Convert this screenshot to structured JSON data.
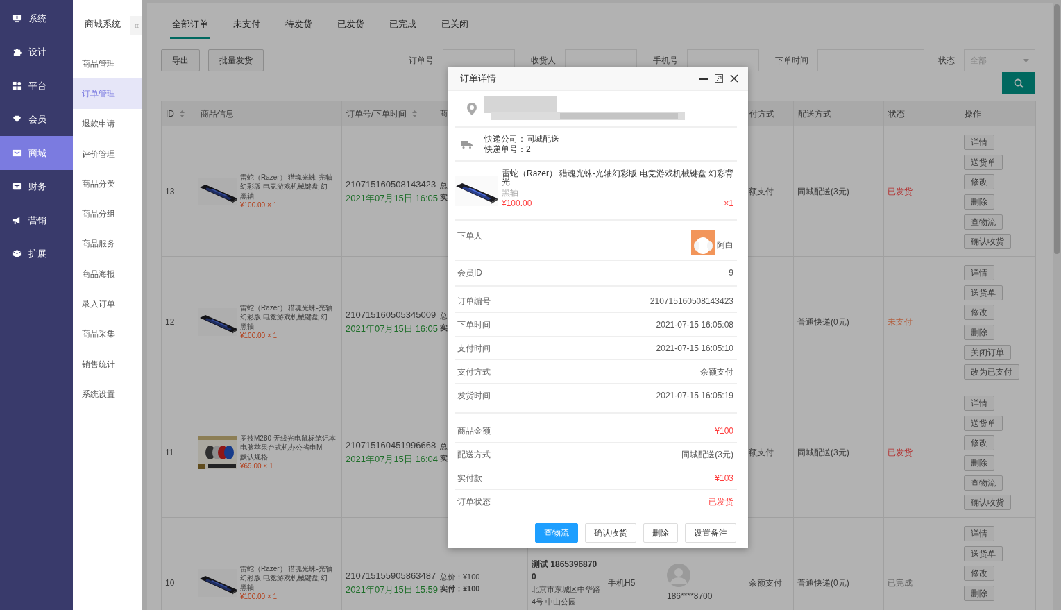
{
  "sidebar": {
    "items": [
      {
        "label": "系统",
        "selected": false
      },
      {
        "label": "设计",
        "selected": false
      },
      {
        "label": "平台",
        "selected": false
      },
      {
        "label": "会员",
        "selected": false
      },
      {
        "label": "商城",
        "selected": true
      },
      {
        "label": "财务",
        "selected": false
      },
      {
        "label": "营销",
        "selected": false
      },
      {
        "label": "扩展",
        "selected": false
      }
    ]
  },
  "subnav": {
    "title": "商城系统",
    "collapse": "«",
    "items": [
      {
        "label": "商品管理",
        "selected": false
      },
      {
        "label": "订单管理",
        "selected": true
      },
      {
        "label": "退款申请",
        "selected": false
      },
      {
        "label": "评价管理",
        "selected": false
      },
      {
        "label": "商品分类",
        "selected": false
      },
      {
        "label": "商品分组",
        "selected": false
      },
      {
        "label": "商品服务",
        "selected": false
      },
      {
        "label": "商品海报",
        "selected": false
      },
      {
        "label": "录入订单",
        "selected": false
      },
      {
        "label": "商品采集",
        "selected": false
      },
      {
        "label": "销售统计",
        "selected": false
      },
      {
        "label": "系统设置",
        "selected": false
      }
    ]
  },
  "tabs": [
    {
      "label": "全部订单",
      "selected": true
    },
    {
      "label": "未支付",
      "selected": false
    },
    {
      "label": "待发货",
      "selected": false
    },
    {
      "label": "已发货",
      "selected": false
    },
    {
      "label": "已完成",
      "selected": false
    },
    {
      "label": "已关闭",
      "selected": false
    }
  ],
  "toolbar": {
    "buttons": [
      "导出",
      "批量发货"
    ],
    "filters": [
      {
        "label": "订单号",
        "kind": "input"
      },
      {
        "label": "收货人",
        "kind": "input"
      },
      {
        "label": "手机号",
        "kind": "input"
      },
      {
        "label": "下单时间",
        "kind": "wide"
      },
      {
        "label": "状态",
        "kind": "select",
        "placeholder": "全部"
      }
    ]
  },
  "table": {
    "columns": [
      {
        "label": "ID",
        "sortable": true
      },
      {
        "label": "商品信息",
        "sortable": false
      },
      {
        "label": "订单号/下单时间",
        "sortable": true
      },
      {
        "label": "商"
      },
      {
        "label": "付方式",
        "sortable": false
      },
      {
        "label": "配送方式",
        "sortable": false
      },
      {
        "label": "状态",
        "sortable": false
      },
      {
        "label": "操作",
        "sortable": false
      }
    ],
    "rows": [
      {
        "id": "13",
        "product": {
          "name": "雷蛇（Razer） 猎魂光蛛-光轴幻彩版 电竞游戏机械键盘 幻",
          "spec": "黑轴",
          "price": "¥100.00 × 1"
        },
        "order": {
          "number": "210715160508143423",
          "time": "2021年07月15日 16:05"
        },
        "amount": {
          "total": "总",
          "paid": "实"
        },
        "pay": "额支付",
        "shipping": "同城配送(3元)",
        "status": {
          "text": "已发货",
          "kind": "shipped"
        },
        "actions": [
          "详情",
          "送货单",
          "修改",
          "删除",
          "查物流",
          "确认收货"
        ]
      },
      {
        "id": "12",
        "product": {
          "name": "雷蛇（Razer） 猎魂光蛛-光轴幻彩版 电竞游戏机械键盘 幻",
          "spec": "黑轴",
          "price": "¥100.00 × 1"
        },
        "order": {
          "number": "210715160505345009",
          "time": "2021年07月15日 16:05"
        },
        "amount": {
          "total": "总",
          "paid": "实"
        },
        "shipping": "普通快递(0元)",
        "status": {
          "text": "未支付",
          "kind": "unpaid"
        },
        "actions": [
          "详情",
          "送货单",
          "修改",
          "删除",
          "关闭订单",
          "改为已支付"
        ]
      },
      {
        "id": "11",
        "product": {
          "name": "罗技M280 无线光电鼠标笔记本电脑苹果台式机办公省电M",
          "spec": "默认规格",
          "price": "¥69.00 × 1"
        },
        "order": {
          "number": "210715160451996668",
          "time": "2021年07月15日 16:04"
        },
        "amount": {
          "total": "总",
          "paid": "实"
        },
        "pay": "额支付",
        "shipping": "同城配送(3元)",
        "status": {
          "text": "已发货",
          "kind": "shipped"
        },
        "actions": [
          "详情",
          "送货单",
          "修改",
          "删除",
          "查物流",
          "确认收货"
        ]
      },
      {
        "id": "10",
        "product": {
          "name": "雷蛇（Razer） 猎魂光蛛-光轴幻彩版 电竞游戏机械键盘 幻",
          "spec": "黑轴",
          "price": "¥100.00 × 1"
        },
        "order": {
          "number": "210715155905863487",
          "time": "2021年07月15日 15:59"
        },
        "amount": {
          "total": "总价：¥100",
          "paid": "实付：¥100"
        },
        "receiver": {
          "contact": "测试 18653968700",
          "address": "北京市东城区中华路4号 中山公园"
        },
        "source": "手机H5",
        "user": {
          "phone": "186****8700"
        },
        "pay": "余额支付",
        "shipping": "普通快递(0元)",
        "status": {
          "text": "已完成",
          "kind": "done"
        },
        "actions": [
          "详情",
          "送货单",
          "修改",
          "删除"
        ]
      }
    ]
  },
  "order_detail": {
    "title": "订单详情",
    "shipping": {
      "company": "快递公司：同城配送",
      "number": "快递单号：2"
    },
    "product": {
      "name": "雷蛇（Razer） 猎魂光蛛-光轴幻彩版 电竞游戏机械键盘 幻彩背光",
      "spec": "黑轴",
      "price": "¥100.00",
      "quantity": "×1"
    },
    "buyer": {
      "label": "下单人",
      "name": "阿白"
    },
    "member": {
      "label": "会员ID",
      "value": "9"
    },
    "sections": [
      [
        {
          "label": "订单编号",
          "value": "210715160508143423",
          "highlight": false
        },
        {
          "label": "下单时间",
          "value": "2021-07-15 16:05:08",
          "highlight": false
        },
        {
          "label": "支付时间",
          "value": "2021-07-15 16:05:10",
          "highlight": false
        },
        {
          "label": "支付方式",
          "value": "余额支付",
          "highlight": false
        },
        {
          "label": "发货时间",
          "value": "2021-07-15 16:05:19",
          "highlight": false
        }
      ],
      [
        {
          "label": "商品金额",
          "value": "¥100",
          "highlight": true
        },
        {
          "label": "配送方式",
          "value": "同城配送(3元)",
          "highlight": false
        },
        {
          "label": "实付款",
          "value": "¥103",
          "highlight": true
        },
        {
          "label": "订单状态",
          "value": "已发货",
          "highlight": true
        }
      ]
    ],
    "buttons": [
      {
        "label": "查物流",
        "primary": true
      },
      {
        "label": "确认收货",
        "primary": false
      },
      {
        "label": "删除",
        "primary": false
      },
      {
        "label": "设置备注",
        "primary": false
      }
    ]
  }
}
